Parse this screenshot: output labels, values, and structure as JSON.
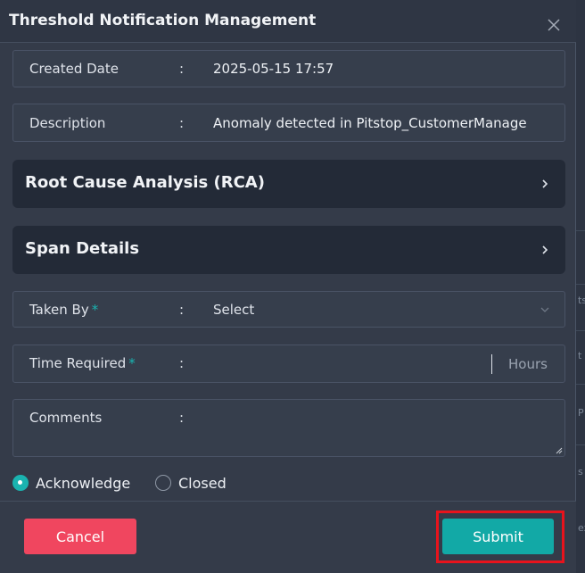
{
  "modal": {
    "title": "Threshold Notification Management"
  },
  "fields": {
    "created_date": {
      "label": "Created Date",
      "value": "2025-05-15 17:57"
    },
    "description": {
      "label": "Description",
      "value": "Anomaly detected in Pitstop_CustomerManage"
    },
    "taken_by": {
      "label": "Taken By",
      "required_mark": "*",
      "value": "Select"
    },
    "time_required": {
      "label": "Time Required",
      "required_mark": "*",
      "value": "",
      "unit": "Hours"
    },
    "comments": {
      "label": "Comments",
      "value": ""
    },
    "separator": ":"
  },
  "accordions": {
    "rca": {
      "title": "Root Cause Analysis (RCA)"
    },
    "span": {
      "title": "Span Details"
    }
  },
  "status": {
    "options": [
      {
        "label": "Acknowledge",
        "checked": true
      },
      {
        "label": "Closed",
        "checked": false
      }
    ]
  },
  "footer": {
    "cancel_label": "Cancel",
    "submit_label": "Submit"
  },
  "background_fragments": [
    "ts",
    "t",
    "P",
    "s",
    "ex"
  ],
  "colors": {
    "accent": "#12a9a6",
    "danger": "#f0465f",
    "highlight": "#e8131c"
  },
  "icons": [
    "close-icon",
    "chevron-right-icon",
    "chevron-down-icon",
    "resize-grip-icon"
  ]
}
